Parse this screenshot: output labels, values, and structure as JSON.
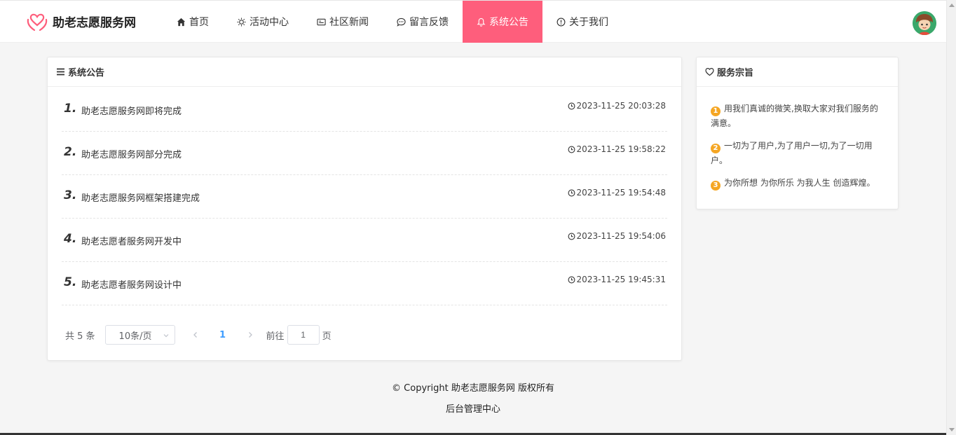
{
  "brand": {
    "name": "助老志愿服务网"
  },
  "nav": {
    "items": [
      {
        "label": "首页",
        "icon": "home-icon"
      },
      {
        "label": "活动中心",
        "icon": "sun-icon"
      },
      {
        "label": "社区新闻",
        "icon": "news-icon"
      },
      {
        "label": "留言反馈",
        "icon": "chat-icon"
      },
      {
        "label": "系统公告",
        "icon": "bell-icon"
      },
      {
        "label": "关于我们",
        "icon": "info-icon"
      }
    ],
    "active_index": 4
  },
  "announcements": {
    "title": "系统公告",
    "items": [
      {
        "num": "1.",
        "title": "助老志愿服务网即将完成",
        "time": "2023-11-25 20:03:28"
      },
      {
        "num": "2.",
        "title": "助老志愿服务网部分完成",
        "time": "2023-11-25 19:58:22"
      },
      {
        "num": "3.",
        "title": "助老志愿服务网框架搭建完成",
        "time": "2023-11-25 19:54:48"
      },
      {
        "num": "4.",
        "title": "助老志愿者服务网开发中",
        "time": "2023-11-25 19:54:06"
      },
      {
        "num": "5.",
        "title": "助老志愿者服务网设计中",
        "time": "2023-11-25 19:45:31"
      }
    ]
  },
  "pagination": {
    "total": "共 5 条",
    "page_size": "10条/页",
    "current_page": "1",
    "goto_label": "前往",
    "goto_value": "1",
    "goto_suffix": "页"
  },
  "service": {
    "title": "服务宗旨",
    "items": [
      {
        "badge": "1",
        "text": "用我们真诚的微笑,换取大家对我们服务的满意。"
      },
      {
        "badge": "2",
        "text": "一切为了用户,为了用户一切,为了一切用户。"
      },
      {
        "badge": "3",
        "text": "为你所想 为你所乐 为我人生 创造辉煌。"
      }
    ]
  },
  "footer": {
    "copyright": "© Copyright 助老志愿服务网 版权所有",
    "admin_link": "后台管理中心"
  },
  "colors": {
    "accent": "#fe5e7c",
    "badge": "#f5a623",
    "page_active": "#409eff"
  }
}
